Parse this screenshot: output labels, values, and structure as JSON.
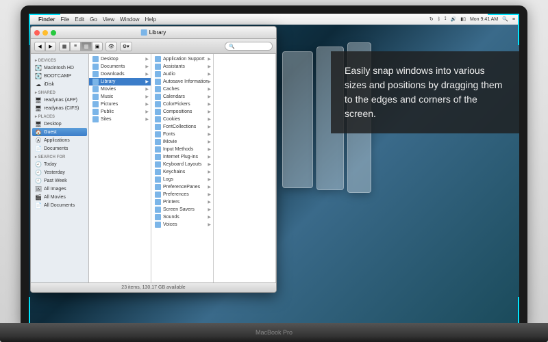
{
  "laptop_label": "MacBook Pro",
  "menubar": {
    "app": "Finder",
    "items": [
      "File",
      "Edit",
      "Go",
      "View",
      "Window",
      "Help"
    ],
    "clock": "Mon 9:41 AM"
  },
  "window": {
    "title": "Library",
    "search_placeholder": "Q",
    "status": "23 items, 130.17 GB available"
  },
  "sidebar": {
    "sections": [
      {
        "header": "DEVICES",
        "items": [
          {
            "label": "Macintosh HD",
            "icon": "💽"
          },
          {
            "label": "BOOTCAMP",
            "icon": "💽"
          },
          {
            "label": "iDisk",
            "icon": "☁"
          }
        ]
      },
      {
        "header": "SHARED",
        "items": [
          {
            "label": "readynas (AFP)",
            "icon": "🖥"
          },
          {
            "label": "readynas (CIFS)",
            "icon": "🖥"
          }
        ]
      },
      {
        "header": "PLACES",
        "items": [
          {
            "label": "Desktop",
            "icon": "🖥"
          },
          {
            "label": "Guest",
            "icon": "🏠",
            "selected": true
          },
          {
            "label": "Applications",
            "icon": "Ⓐ"
          },
          {
            "label": "Documents",
            "icon": "📄"
          }
        ]
      },
      {
        "header": "SEARCH FOR",
        "items": [
          {
            "label": "Today",
            "icon": "🕘"
          },
          {
            "label": "Yesterday",
            "icon": "🕘"
          },
          {
            "label": "Past Week",
            "icon": "🕘"
          },
          {
            "label": "All Images",
            "icon": "🖼"
          },
          {
            "label": "All Movies",
            "icon": "🎬"
          },
          {
            "label": "All Documents",
            "icon": "📄"
          }
        ]
      }
    ]
  },
  "columns": [
    {
      "items": [
        {
          "label": "Desktop"
        },
        {
          "label": "Documents"
        },
        {
          "label": "Downloads"
        },
        {
          "label": "Library",
          "selected": true
        },
        {
          "label": "Movies"
        },
        {
          "label": "Music"
        },
        {
          "label": "Pictures"
        },
        {
          "label": "Public"
        },
        {
          "label": "Sites"
        }
      ]
    },
    {
      "items": [
        {
          "label": "Application Support"
        },
        {
          "label": "Assistants"
        },
        {
          "label": "Audio"
        },
        {
          "label": "Autosave Information"
        },
        {
          "label": "Caches"
        },
        {
          "label": "Calendars"
        },
        {
          "label": "ColorPickers"
        },
        {
          "label": "Compositions"
        },
        {
          "label": "Cookies"
        },
        {
          "label": "FontCollections"
        },
        {
          "label": "Fonts"
        },
        {
          "label": "iMovie"
        },
        {
          "label": "Input Methods"
        },
        {
          "label": "Internet Plug-ins"
        },
        {
          "label": "Keyboard Layouts"
        },
        {
          "label": "Keychains"
        },
        {
          "label": "Logs"
        },
        {
          "label": "PreferencePanes"
        },
        {
          "label": "Preferences"
        },
        {
          "label": "Printers"
        },
        {
          "label": "Screen Savers"
        },
        {
          "label": "Sounds"
        },
        {
          "label": "Voices"
        }
      ]
    }
  ],
  "marketing_text": "Easily snap windows into various sizes and positions by dragging them to the edges and corners of the screen."
}
